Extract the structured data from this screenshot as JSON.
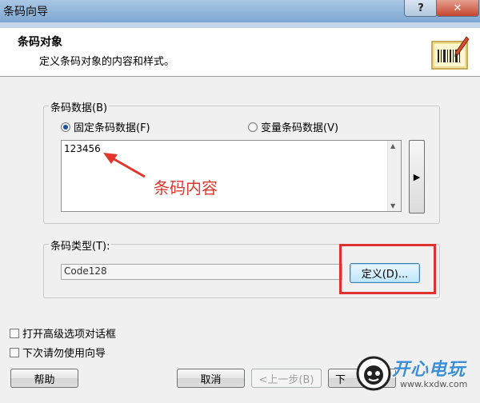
{
  "window": {
    "title": "条码向导",
    "help_btn": "?",
    "close_btn": "✕"
  },
  "header": {
    "title": "条码对象",
    "subtitle": "定义条码对象的内容和样式。",
    "icon": "barcode-pen-icon"
  },
  "barcode_data": {
    "label": "条码数据(B)",
    "fixed_option": "固定条码数据(F)",
    "variable_option": "变量条码数据(V)",
    "selected": "fixed",
    "value": "123456",
    "expand_btn": "▶"
  },
  "annotation": {
    "text": "条码内容",
    "color": "#e0362c"
  },
  "barcode_type": {
    "label": "条码类型(T):",
    "value": "Code128",
    "define_btn": "定义(D)..."
  },
  "options": {
    "advanced": "打开高级选项对话框",
    "no_wizard": "下次请勿使用向导"
  },
  "footer": {
    "help": "帮助",
    "cancel": "取消",
    "prev": "<上一步(B)",
    "next": "下"
  },
  "watermark": {
    "text": "开心电玩",
    "url": "www.kxdw.com"
  }
}
